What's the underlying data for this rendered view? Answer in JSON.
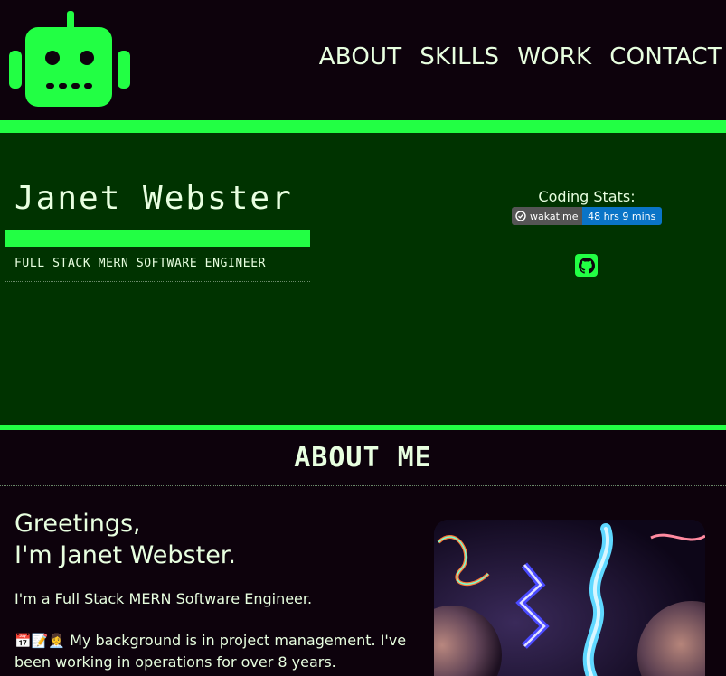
{
  "header": {
    "logo_icon": "robot-icon",
    "nav": [
      "ABOUT",
      "SKILLS",
      "WORK",
      "CONTACT"
    ]
  },
  "hero": {
    "name": "Janet Webster",
    "role": "FULL STACK MERN SOFTWARE ENGINEER",
    "stats_label": "Coding Stats:",
    "badge_left": "wakatime",
    "badge_right": "48 hrs 9 mins",
    "github_icon": "github-icon"
  },
  "about": {
    "title": "ABOUT ME",
    "greeting_line1": "Greetings,",
    "greeting_line2": "I'm Janet Webster.",
    "intro": "I'm a Full Stack MERN Software Engineer.",
    "emojis": "📅📝👩‍💼",
    "background": "My background is in project management. I've been working in operations for over 8 years."
  },
  "colors": {
    "bg": "#0d020c",
    "accent": "#22ff44",
    "hero_bg": "#003300",
    "badge_blue": "#0a74c7"
  }
}
